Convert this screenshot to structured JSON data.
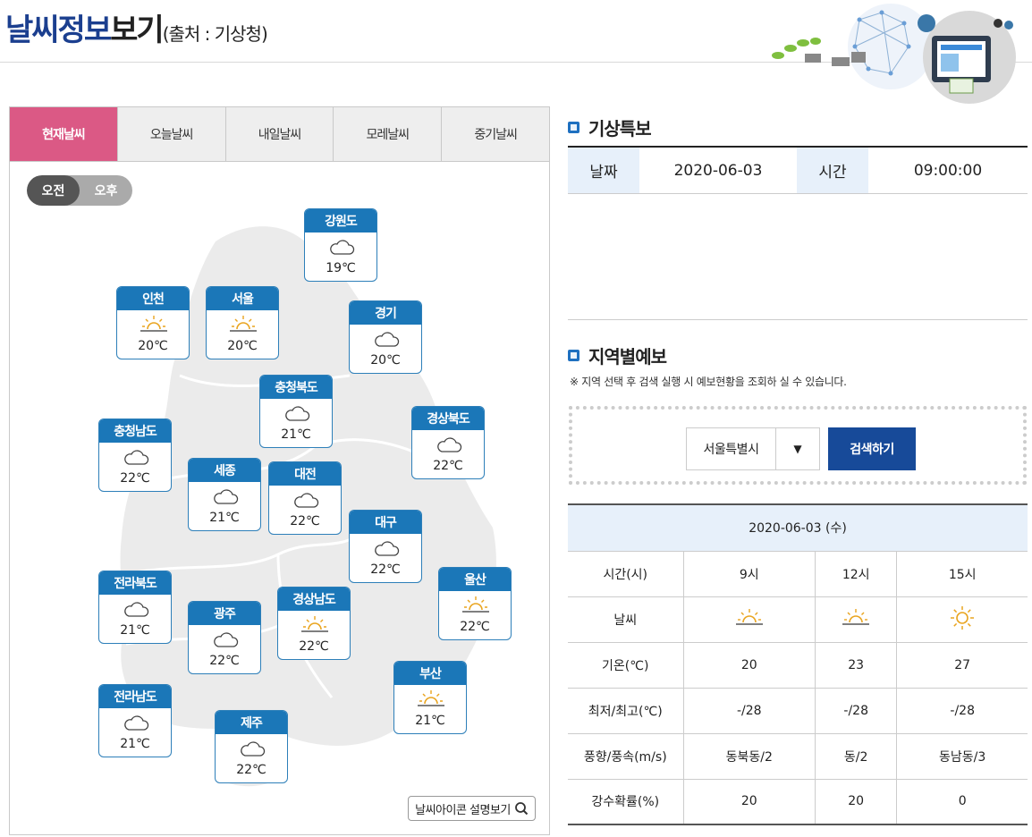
{
  "header": {
    "title_part1": "날씨정보",
    "title_part2": "보기",
    "title_source": "(출처 : 기상청)"
  },
  "tabs": [
    {
      "label": "현재날씨",
      "active": true
    },
    {
      "label": "오늘날씨",
      "active": false
    },
    {
      "label": "내일날씨",
      "active": false
    },
    {
      "label": "모레날씨",
      "active": false
    },
    {
      "label": "중기날씨",
      "active": false
    }
  ],
  "ampm": {
    "am": "오전",
    "pm": "오후",
    "selected": "오전"
  },
  "regions": [
    {
      "name": "강원도",
      "icon": "cloud-icon",
      "temp": "19℃"
    },
    {
      "name": "인천",
      "icon": "sunrise-icon",
      "temp": "20℃"
    },
    {
      "name": "서울",
      "icon": "sunrise-icon",
      "temp": "20℃"
    },
    {
      "name": "경기",
      "icon": "cloud-icon",
      "temp": "20℃"
    },
    {
      "name": "충청북도",
      "icon": "cloud-icon",
      "temp": "21℃"
    },
    {
      "name": "충청남도",
      "icon": "cloud-icon",
      "temp": "22℃"
    },
    {
      "name": "경상북도",
      "icon": "cloud-icon",
      "temp": "22℃"
    },
    {
      "name": "세종",
      "icon": "cloud-icon",
      "temp": "21℃"
    },
    {
      "name": "대전",
      "icon": "cloud-icon",
      "temp": "22℃"
    },
    {
      "name": "대구",
      "icon": "cloud-icon",
      "temp": "22℃"
    },
    {
      "name": "전라북도",
      "icon": "cloud-icon",
      "temp": "21℃"
    },
    {
      "name": "광주",
      "icon": "cloud-icon",
      "temp": "22℃"
    },
    {
      "name": "경상남도",
      "icon": "sunrise-icon",
      "temp": "22℃"
    },
    {
      "name": "울산",
      "icon": "sunrise-icon",
      "temp": "22℃"
    },
    {
      "name": "부산",
      "icon": "sunrise-icon",
      "temp": "21℃"
    },
    {
      "name": "전라남도",
      "icon": "cloud-icon",
      "temp": "21℃"
    },
    {
      "name": "제주",
      "icon": "cloud-icon",
      "temp": "22℃"
    }
  ],
  "legend_button": "날씨아이콘 설명보기",
  "alert": {
    "heading": "기상특보",
    "date_label": "날짜",
    "date_value": "2020-06-03",
    "time_label": "시간",
    "time_value": "09:00:00"
  },
  "regional": {
    "heading": "지역별예보",
    "note": "※ 지역 선택 후 검색 실행 시 예보현황을 조회하 실 수 있습니다.",
    "select_value": "서울특별시",
    "search_button": "검색하기"
  },
  "forecast": {
    "date_header": "2020-06-03 (수)",
    "rows": [
      {
        "label": "시간(시)",
        "cells": [
          "9시",
          "12시",
          "15시"
        ]
      },
      {
        "label": "날씨",
        "cells": [
          "sunrise-icon",
          "sunrise-icon",
          "sun-icon"
        ]
      },
      {
        "label": "기온(℃)",
        "cells": [
          "20",
          "23",
          "27"
        ]
      },
      {
        "label": "최저/최고(℃)",
        "cells": [
          "-/28",
          "-/28",
          "-/28"
        ]
      },
      {
        "label": "풍향/풍속(m/s)",
        "cells": [
          "동북동/2",
          "동/2",
          "동남동/3"
        ]
      },
      {
        "label": "강수확률(%)",
        "cells": [
          "20",
          "20",
          "0"
        ]
      }
    ]
  },
  "colors": {
    "brand_blue": "#1b3f8f",
    "tab_active": "#db5985",
    "card_header": "#1b77b8",
    "search_button": "#174a99",
    "sun": "#e9a41f"
  }
}
